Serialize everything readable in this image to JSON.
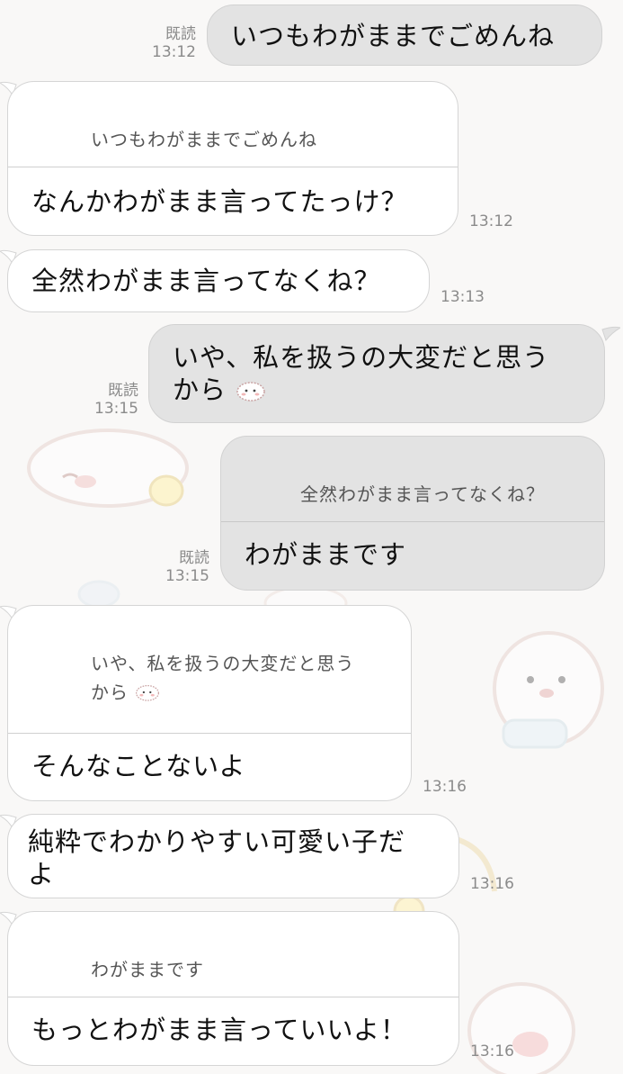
{
  "messages": [
    {
      "side": "sent",
      "text": "いつもわがままでごめんね",
      "read": "既読",
      "time": "13:12"
    },
    {
      "side": "received",
      "quote": "いつもわがままでごめんね",
      "text": "なんかわがまま言ってたっけ？",
      "time": "13:12"
    },
    {
      "side": "received",
      "text": "全然わがまま言ってなくね？",
      "time": "13:13"
    },
    {
      "side": "sent",
      "text_line1": "いや、私を扱うの大変だと思う",
      "text_line2": "から",
      "read": "既読",
      "time": "13:15"
    },
    {
      "side": "sent",
      "quote": "全然わがまま言ってなくね？",
      "text": "わがままです",
      "read": "既読",
      "time": "13:15"
    },
    {
      "side": "received",
      "quote_line1": "いや、私を扱うの大変だと思う",
      "quote_line2": "から",
      "text": "そんなことないよ",
      "time": "13:16"
    },
    {
      "side": "received",
      "text_line1": "純粋でわかりやすい可愛い子だ",
      "text_line2": "よ",
      "time": "13:16"
    },
    {
      "side": "received",
      "quote": "わがままです",
      "text": "もっとわがまま言っていいよ！",
      "time": "13:16"
    }
  ],
  "icons": {
    "sticker": "fluffy-dog-sticker-icon"
  }
}
